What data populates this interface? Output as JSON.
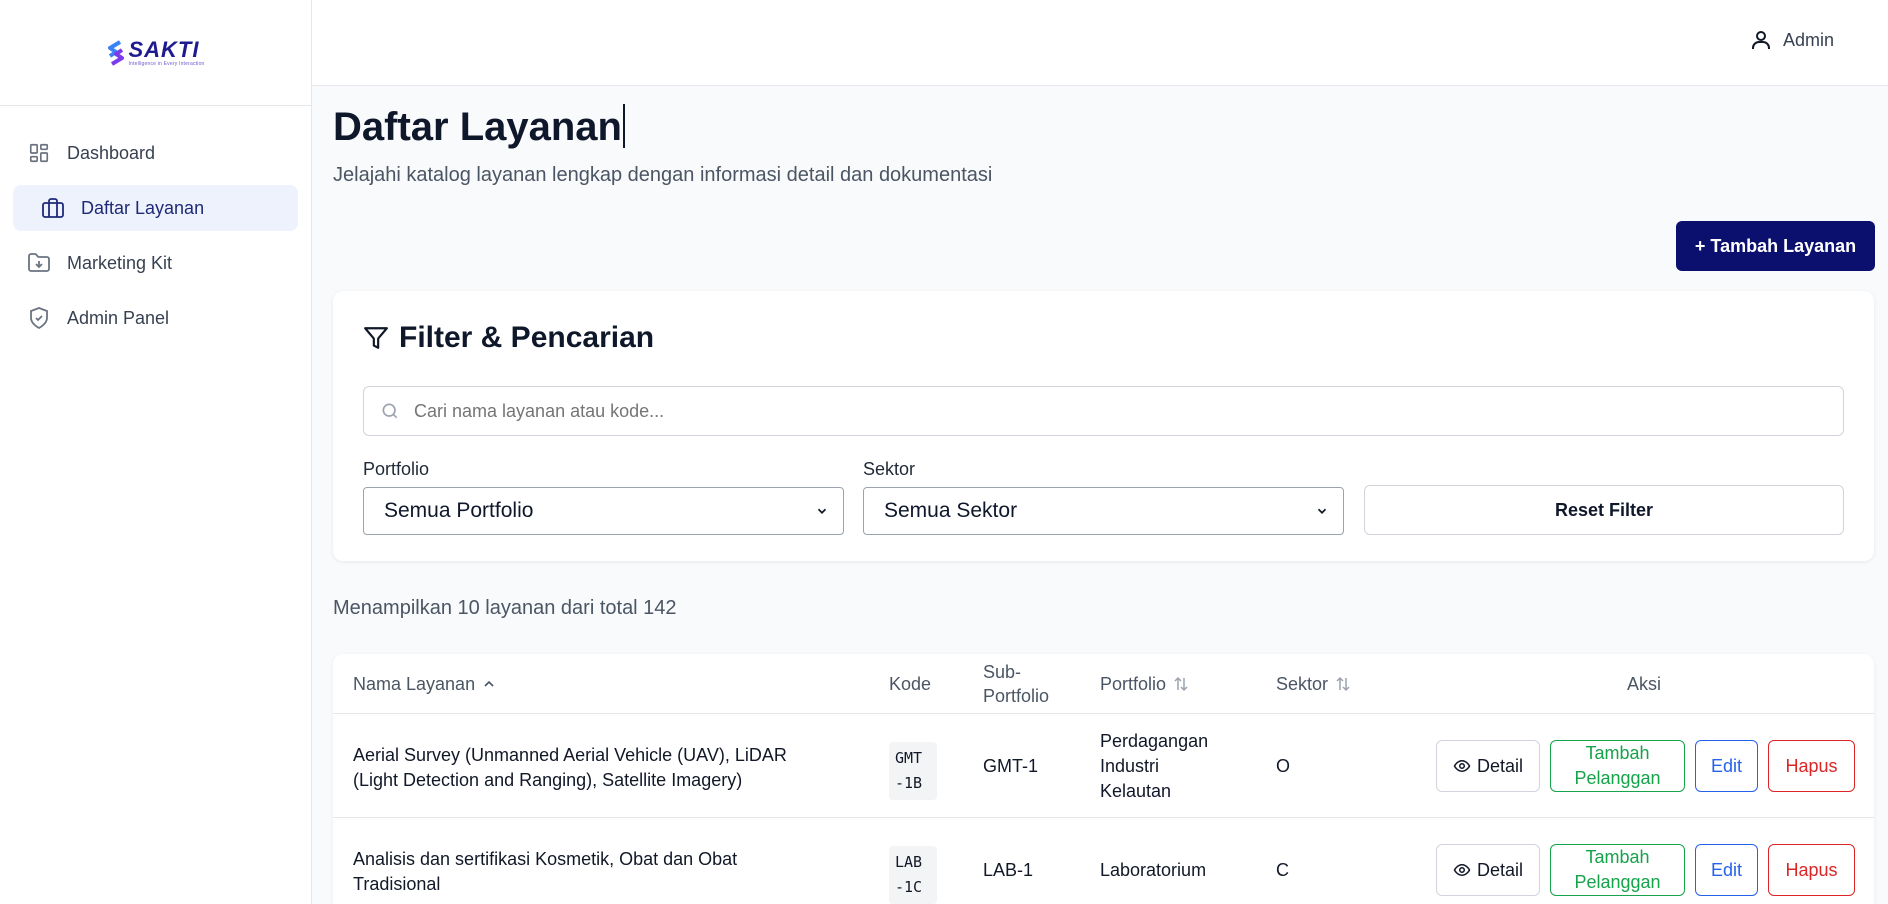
{
  "brand": {
    "name": "SAKTI",
    "tagline": "Intelligence in Every Interaction"
  },
  "sidebar": {
    "items": [
      {
        "label": "Dashboard",
        "icon": "grid-icon",
        "active": false
      },
      {
        "label": "Daftar Layanan",
        "icon": "briefcase-icon",
        "active": true
      },
      {
        "label": "Marketing Kit",
        "icon": "folder-download-icon",
        "active": false
      },
      {
        "label": "Admin Panel",
        "icon": "shield-icon",
        "active": false
      }
    ]
  },
  "header": {
    "user_label": "Admin"
  },
  "page": {
    "title": "Daftar Layanan",
    "subtitle": "Jelajahi katalog layanan lengkap dengan informasi detail dan dokumentasi",
    "add_button": "+ Tambah Layanan"
  },
  "filter": {
    "title": "Filter & Pencarian",
    "search_placeholder": "Cari nama layanan atau kode...",
    "portfolio_label": "Portfolio",
    "portfolio_value": "Semua Portfolio",
    "sektor_label": "Sektor",
    "sektor_value": "Semua Sektor",
    "reset_label": "Reset Filter"
  },
  "summary": {
    "text": "Menampilkan 10 layanan dari total 142"
  },
  "table": {
    "headers": {
      "nama": "Nama Layanan",
      "kode": "Kode",
      "sub_portfolio_1": "Sub-",
      "sub_portfolio_2": "Portfolio",
      "portfolio": "Portfolio",
      "sektor": "Sektor",
      "aksi": "Aksi"
    },
    "actions": {
      "detail": "Detail",
      "tambah_1": "Tambah",
      "tambah_2": "Pelanggan",
      "edit": "Edit",
      "hapus": "Hapus"
    },
    "rows": [
      {
        "nama_1": "Aerial Survey (Unmanned Aerial Vehicle (UAV), LiDAR",
        "nama_2": "(Light Detection and Ranging), Satellite Imagery)",
        "kode": "GMT-1B",
        "sub_portfolio": "GMT-1",
        "portfolio_1": "Perdagangan",
        "portfolio_2": "Industri",
        "portfolio_3": "Kelautan",
        "sektor": "O"
      },
      {
        "nama_1": "Analisis dan sertifikasi Kosmetik, Obat dan Obat",
        "nama_2": "Tradisional",
        "kode": "LAB-1C",
        "sub_portfolio": "LAB-1",
        "portfolio_1": "Laboratorium",
        "portfolio_2": "",
        "portfolio_3": "",
        "sektor": "C"
      }
    ]
  }
}
